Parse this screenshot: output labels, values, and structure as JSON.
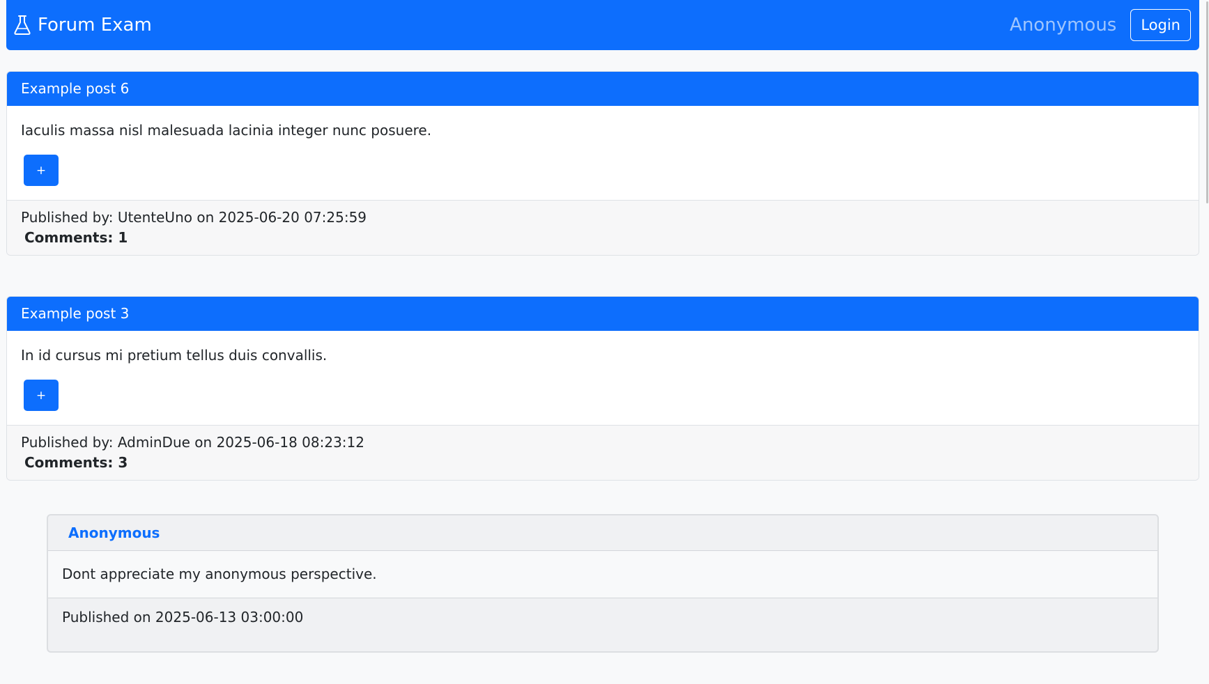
{
  "navbar": {
    "brand": "Forum Exam",
    "brand_icon": "flask-icon",
    "user": "Anonymous",
    "login_label": "Login"
  },
  "posts": [
    {
      "title": "Example post 6",
      "body": "Iaculis massa nisl malesuada lacinia integer nunc posuere.",
      "add_label": "+",
      "published": "Published by: UtenteUno on 2025-06-20 07:25:59",
      "comments": "Comments: 1"
    },
    {
      "title": "Example post 3",
      "body": "In id cursus mi pretium tellus duis convallis.",
      "add_label": "+",
      "published": "Published by: AdminDue on 2025-06-18 08:23:12",
      "comments": "Comments: 3"
    }
  ],
  "comment": {
    "author": "Anonymous",
    "text": "Dont appreciate my anonymous perspective.",
    "published": "Published on 2025-06-13 03:00:00"
  },
  "colors": {
    "primary": "#0d6efd",
    "background": "#f8f9fa"
  }
}
